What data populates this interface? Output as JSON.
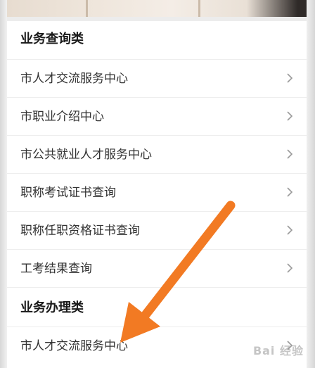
{
  "sections": [
    {
      "title": "业务查询类",
      "items": [
        {
          "label": "市人才交流服务中心"
        },
        {
          "label": "市职业介绍中心"
        },
        {
          "label": "市公共就业人才服务中心"
        },
        {
          "label": "职称考试证书查询"
        },
        {
          "label": "职称任职资格证书查询"
        },
        {
          "label": "工考结果查询"
        }
      ]
    },
    {
      "title": "业务办理类",
      "items": [
        {
          "label": "市人才交流服务中心"
        }
      ]
    }
  ],
  "annotation": {
    "arrow_color": "#f27a23"
  },
  "watermark": {
    "text": "Bai 经验"
  },
  "colors": {
    "row_text": "#333333",
    "chevron": "#9a9a9a"
  }
}
